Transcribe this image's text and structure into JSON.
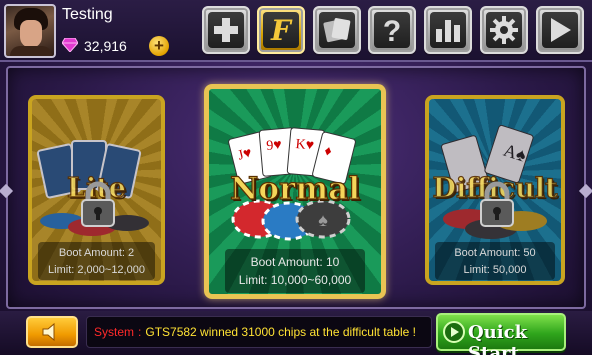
{
  "header": {
    "username": "Testing",
    "chips": "32,916",
    "add_chips_label": "+"
  },
  "toolbar": {
    "buttons": [
      {
        "name": "plus-icon"
      },
      {
        "name": "facebook-icon"
      },
      {
        "name": "cards-icon"
      },
      {
        "name": "help-icon",
        "label": "?"
      },
      {
        "name": "stats-icon"
      },
      {
        "name": "gear-icon"
      },
      {
        "name": "arrow-right-icon"
      }
    ]
  },
  "rooms": {
    "left": {
      "title": "Lite",
      "boot": "Boot Amount: 2",
      "limit": "Limit: 2,000~12,000",
      "locked": true
    },
    "center": {
      "title": "Normal",
      "boot": "Boot Amount: 10",
      "limit": "Limit: 10,000~60,000",
      "locked": false
    },
    "right": {
      "title": "Difficult",
      "boot": "Boot Amount: 50",
      "limit": "Limit: 50,000",
      "locked": true
    }
  },
  "ticker": {
    "system": "System",
    "separator": ":",
    "message": "GTS7582 winned 31000 chips at the difficult table !"
  },
  "quick_start": {
    "label": "Quick Start"
  },
  "colors": {
    "gold": "#f4d65a",
    "green": "#1a9a5a",
    "blue": "#1b8fb0",
    "system_red": "#ff2a2a",
    "message_yellow": "#ffe234"
  }
}
